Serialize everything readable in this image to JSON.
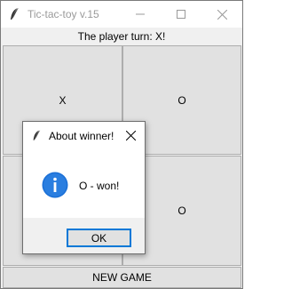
{
  "window": {
    "title": "Tic-tac-toy v.15",
    "feather_icon": "feather-icon",
    "controls": [
      "minimize-icon",
      "maximize-icon",
      "close-icon"
    ]
  },
  "status": {
    "turn_text": "The player turn: X!"
  },
  "board": {
    "cells": [
      {
        "value": "X"
      },
      {
        "value": "O"
      },
      {
        "value": ""
      },
      {
        "value": "O"
      }
    ]
  },
  "new_game_label": "NEW GAME",
  "dialog": {
    "title": "About winner!",
    "icon": "info-icon",
    "message": "O - won!",
    "ok_label": "OK",
    "accent_color": "#0078d7"
  }
}
